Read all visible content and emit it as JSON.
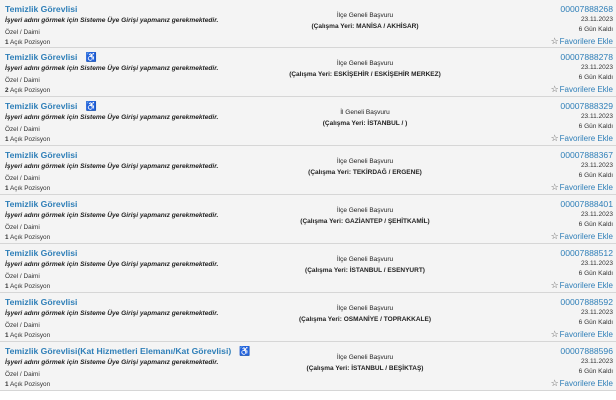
{
  "labels": {
    "warning": "İşyeri adını görmek için Sisteme Üye Girişi yapmanız gerekmektedir.",
    "contract": "Özel / Daimi",
    "positions_suffix": "Açık Pozisyon",
    "favorite": "Favorilere Ekle",
    "work_place_prefix": "(Çalışma Yeri: ",
    "work_place_suffix": ")"
  },
  "jobs": [
    {
      "title": "Temizlik Görevlisi",
      "has_access_icon": false,
      "positions": "1",
      "scope": "İlçe Geneli Başvuru",
      "location": "MANİSA / AKHİSAR",
      "code": "00007888268",
      "date": "23.11.2023",
      "days_left": "6 Gün Kaldı"
    },
    {
      "title": "Temizlik Görevlisi",
      "has_access_icon": true,
      "positions": "2",
      "scope": "İlçe Geneli Başvuru",
      "location": "ESKİŞEHİR / ESKİŞEHİR MERKEZ",
      "code": "00007888278",
      "date": "23.11.2023",
      "days_left": "6 Gün Kaldı"
    },
    {
      "title": "Temizlik Görevlisi",
      "has_access_icon": true,
      "positions": "1",
      "scope": "İl Geneli Başvuru",
      "location": "İSTANBUL / ",
      "code": "00007888329",
      "date": "23.11.2023",
      "days_left": "6 Gün Kaldı"
    },
    {
      "title": "Temizlik Görevlisi",
      "has_access_icon": false,
      "positions": "1",
      "scope": "İlçe Geneli Başvuru",
      "location": "TEKİRDAĞ / ERGENE",
      "code": "00007888367",
      "date": "23.11.2023",
      "days_left": "6 Gün Kaldı"
    },
    {
      "title": "Temizlik Görevlisi",
      "has_access_icon": false,
      "positions": "1",
      "scope": "İlçe Geneli Başvuru",
      "location": "GAZİANTEP / ŞEHİTKAMİL",
      "code": "00007888401",
      "date": "23.11.2023",
      "days_left": "6 Gün Kaldı"
    },
    {
      "title": "Temizlik Görevlisi",
      "has_access_icon": false,
      "positions": "1",
      "scope": "İlçe Geneli Başvuru",
      "location": "İSTANBUL / ESENYURT",
      "code": "00007888512",
      "date": "23.11.2023",
      "days_left": "6 Gün Kaldı"
    },
    {
      "title": "Temizlik Görevlisi",
      "has_access_icon": false,
      "positions": "1",
      "scope": "İlçe Geneli Başvuru",
      "location": "OSMANİYE / TOPRAKKALE",
      "code": "00007888592",
      "date": "23.11.2023",
      "days_left": "6 Gün Kaldı"
    },
    {
      "title": "Temizlik Görevlisi(Kat Hizmetleri Elemanı/Kat Görevlisi)",
      "has_access_icon": true,
      "positions": "1",
      "scope": "İlçe Geneli Başvuru",
      "location": "İSTANBUL / BEŞİKTAŞ",
      "code": "00007888596",
      "date": "23.11.2023",
      "days_left": "6 Gün Kaldı"
    }
  ]
}
